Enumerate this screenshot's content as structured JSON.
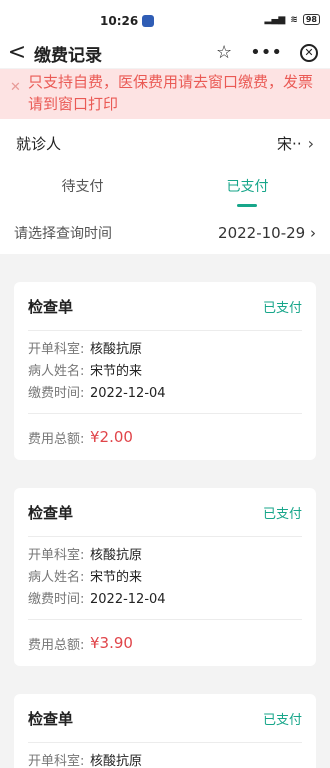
{
  "status_bar": {
    "time": "10:26",
    "battery": "98"
  },
  "nav": {
    "back": "<",
    "title": "缴费记录"
  },
  "notice": {
    "text": "只支持自费，医保费用请去窗口缴费，发票请到窗口打印"
  },
  "visitor": {
    "label": "就诊人",
    "name": "宋··"
  },
  "tabs": [
    {
      "label": "待支付"
    },
    {
      "label": "已支付"
    }
  ],
  "date_filter": {
    "label": "请选择查询时间",
    "value": "2022-10-29"
  },
  "records": [
    {
      "kind": "检查单",
      "status": "已支付",
      "dept_label": "开单科室:",
      "dept": "核酸抗原",
      "patient_label": "病人姓名:",
      "patient": "宋节的来",
      "time_label": "缴费时间:",
      "time": "2022-12-04",
      "total_label": "费用总额:",
      "total": "¥2.00"
    },
    {
      "kind": "检查单",
      "status": "已支付",
      "dept_label": "开单科室:",
      "dept": "核酸抗原",
      "patient_label": "病人姓名:",
      "patient": "宋节的来",
      "time_label": "缴费时间:",
      "time": "2022-12-04",
      "total_label": "费用总额:",
      "total": "¥3.90"
    },
    {
      "kind": "检查单",
      "status": "已支付",
      "dept_label": "开单科室:",
      "dept": "核酸抗原"
    }
  ]
}
